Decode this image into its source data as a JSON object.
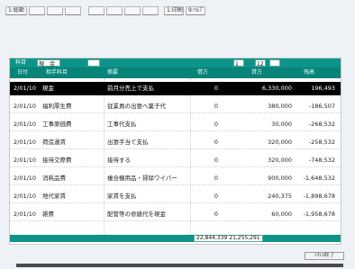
{
  "toolbar": {
    "items": [
      {
        "label": "1:総勘"
      },
      {
        "label": ""
      },
      {
        "label": ""
      },
      {
        "label": ""
      },
      {
        "label": ""
      },
      {
        "label": ""
      },
      {
        "label": ""
      },
      {
        "label": ""
      },
      {
        "label": "1:印刷"
      },
      {
        "label": "9:ﾍﾙﾌﾟ"
      }
    ]
  },
  "ledger_header": {
    "field1_label": "科目",
    "field1_value": "現　金",
    "field2_value": "",
    "page_current": "1",
    "page_total": "12"
  },
  "columns": [
    "日付",
    "相手科目",
    "摘要",
    "借方",
    "貸方",
    "残高"
  ],
  "rows": [
    {
      "date": "2/01/10",
      "account": "現金",
      "memo": "前月分売上で支払",
      "debit": "0",
      "credit": "6,330,000",
      "balance": "196,493"
    },
    {
      "date": "2/01/10",
      "account": "福利厚生費",
      "memo": "従業員の出張へ菓子代",
      "debit": "0",
      "credit": "380,000",
      "balance": "-186,507"
    },
    {
      "date": "2/01/10",
      "account": "工事原価費",
      "memo": "工事代支払",
      "debit": "0",
      "credit": "30,000",
      "balance": "-268,532"
    },
    {
      "date": "2/01/10",
      "account": "荷造運賃",
      "memo": "出張手当て支払",
      "debit": "0",
      "credit": "320,000",
      "balance": "-258,532"
    },
    {
      "date": "2/01/10",
      "account": "接待交際費",
      "memo": "接待する",
      "debit": "0",
      "credit": "320,000",
      "balance": "-748,532"
    },
    {
      "date": "2/01/10",
      "account": "消耗品費",
      "memo": "複合機用品・掃除ワイパー",
      "debit": "0",
      "credit": "900,000",
      "balance": "-1,648,532"
    },
    {
      "date": "2/01/10",
      "account": "地代家賃",
      "memo": "家賃を支払",
      "debit": "0",
      "credit": "240,375",
      "balance": "-1,898,678"
    },
    {
      "date": "2/01/10",
      "account": "雑費",
      "memo": "配管等の修繕代を現金",
      "debit": "0",
      "credit": "60,000",
      "balance": "-1,958,678"
    }
  ],
  "totals": {
    "text": "22,844,339 21,255,291"
  },
  "status_button": {
    "label": "ｼｽﾃﾑ終了"
  },
  "colors": {
    "teal": "#0d9488",
    "teal_dark": "#0a8378",
    "selected_bg": "#000000",
    "bg": "#eef2f6"
  }
}
